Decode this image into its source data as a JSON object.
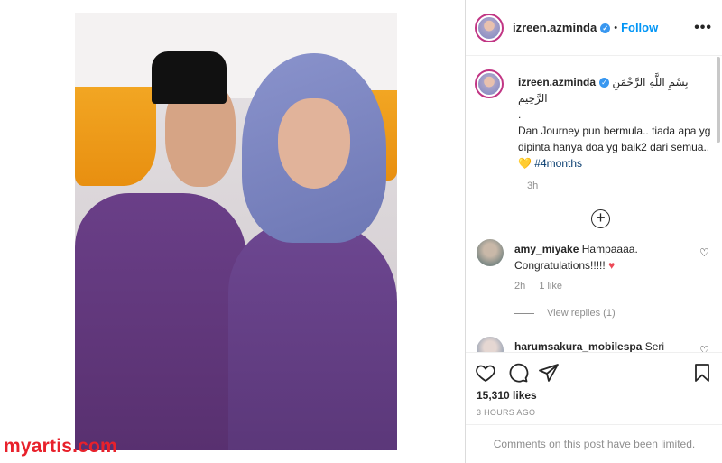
{
  "watermark": "myartis.com",
  "post": {
    "username": "izreen.azminda",
    "verified": true,
    "follow_label": "Follow",
    "separator": "•",
    "caption": {
      "username": "izreen.azminda",
      "arabic": "بِسْمِ اللَّهِ الرَّحْمَنِ الرَّحِيمِ",
      "line_dot": ".",
      "text": "Dan Journey pun bermula.. tiada apa yg dipinta hanya doa yg baik2 dari semua.. ",
      "heart": "💛",
      "hashtag": "#4months",
      "time": "3h"
    },
    "comments": [
      {
        "username": "amy_miyake",
        "text": "Hampaaaa. Congratulations!!!!! ",
        "heart": "♥",
        "time": "2h",
        "likes": "1 like",
        "view_replies": "View replies (1)"
      },
      {
        "username": "harumsakura_mobilespa",
        "text": "Seri"
      }
    ],
    "likes": "15,310 likes",
    "posted_ago": "3 HOURS AGO",
    "comments_limited": "Comments on this post have been limited."
  },
  "icons": {
    "more": "more-options-icon",
    "like": "heart-icon",
    "comment": "comment-icon",
    "share": "share-icon",
    "save": "bookmark-icon",
    "add_comments": "plus-circle-icon"
  }
}
